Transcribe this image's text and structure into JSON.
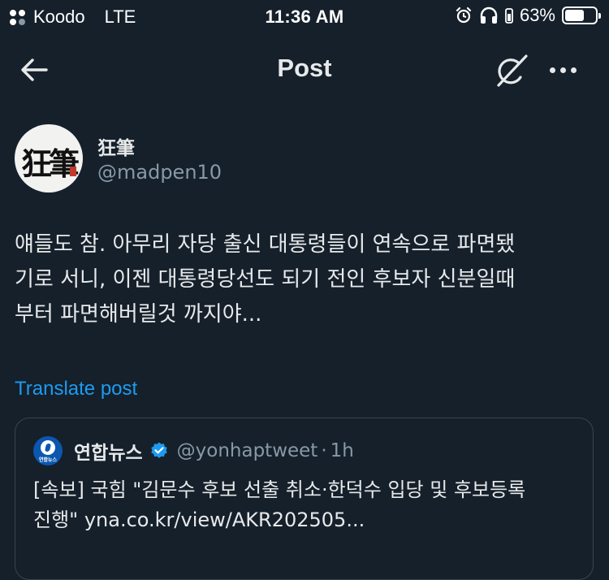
{
  "status_bar": {
    "carrier": "Koodo",
    "network": "LTE",
    "time": "11:36 AM",
    "battery": "63%",
    "battery_level": 0.63
  },
  "nav": {
    "title": "Post",
    "back_icon": "arrow-left-icon",
    "grok_icon": "grok-icon",
    "more_icon": "more-horizontal-icon"
  },
  "post": {
    "author_name": "狂筆",
    "author_handle": "@madpen10",
    "avatar_text": "狂筆",
    "text_lines": [
      "얘들도 참. 아무리 자당 출신 대통령들이 연속으로 파면됐",
      "기로 서니, 이젠 대통령당선도 되기 전인 후보자 신분일때",
      "부터 파면해버릴것 까지야..."
    ],
    "translate_label": "Translate post"
  },
  "quote": {
    "avatar_text": "연합뉴스",
    "name": "연합뉴스",
    "handle": "@yonhaptweet",
    "separator": "·",
    "time": "1h",
    "text_lines": [
      "[속보] 국힘 \"김문수 후보 선출 취소·한덕수 입당 및 후보등록",
      "진행\" yna.co.kr/view/AKR202505..."
    ]
  },
  "colors": {
    "background": "#15202b",
    "text": "#e7e9ea",
    "muted": "#8899a6",
    "accent": "#1d9bf0",
    "border": "#38444d"
  }
}
